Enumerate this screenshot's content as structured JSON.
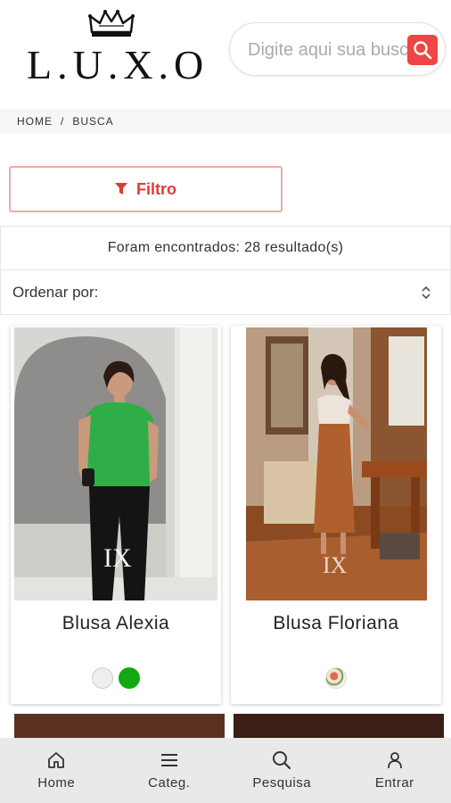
{
  "header": {
    "logo_text": "L.U.X.O",
    "search": {
      "placeholder": "Digite aqui sua busca"
    }
  },
  "breadcrumb": {
    "home": "HOME",
    "separator": "/",
    "current": "BUSCA"
  },
  "filter": {
    "label": "Filtro"
  },
  "results": {
    "text": "Foram encontrados: 28 resultado(s)"
  },
  "sort": {
    "label": "Ordenar por:"
  },
  "products": [
    {
      "name": "Blusa Alexia",
      "swatches": [
        "#eeeeee",
        "#11a811"
      ]
    },
    {
      "name": "Blusa Floriana",
      "swatches": [
        "floral"
      ]
    }
  ],
  "bottom_nav": [
    {
      "label": "Home",
      "icon": "home-icon"
    },
    {
      "label": "Categ.",
      "icon": "menu-icon"
    },
    {
      "label": "Pesquisa",
      "icon": "search-icon"
    },
    {
      "label": "Entrar",
      "icon": "user-icon"
    }
  ],
  "colors": {
    "accent": "#ef4545",
    "filter_border": "#f2a8a8"
  }
}
